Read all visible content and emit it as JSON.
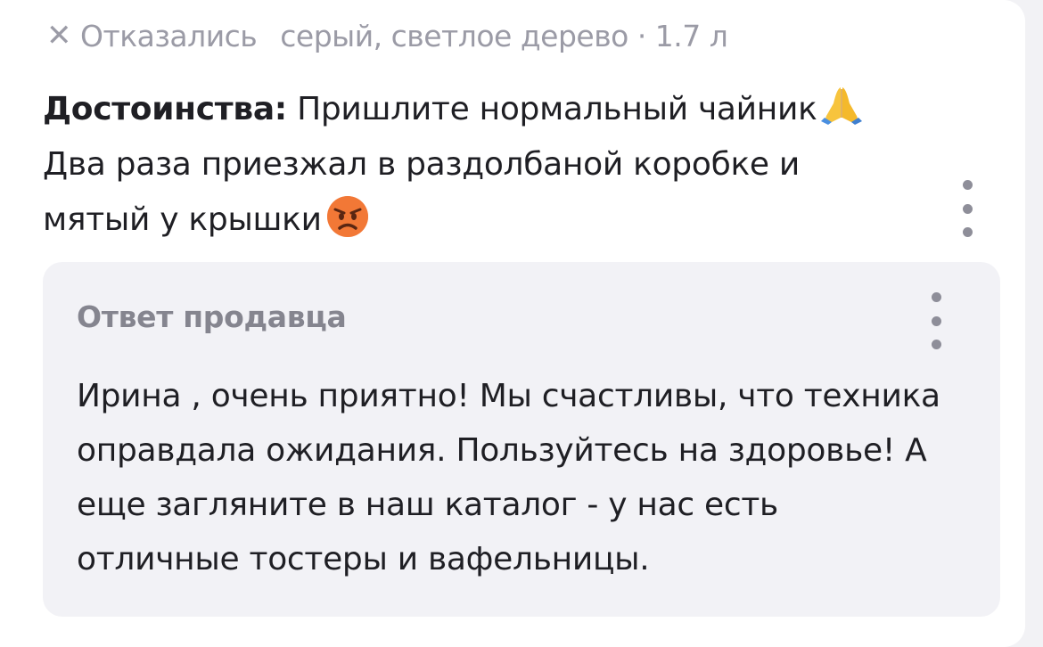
{
  "review": {
    "status_icon": "close-icon",
    "status_text": "Отказались",
    "variant_text": "серый, светлое дерево · 1.7 л",
    "pros_label": "Достоинства:",
    "pros_lines": [
      "Пришлите нормальный чайник",
      "Два раза приезжал в раздолбаной коробке и",
      "мятый у крышки"
    ],
    "emoji_1": "folded-hands-emoji",
    "emoji_2": "angry-face-emoji",
    "more_icon": "kebab-menu-icon"
  },
  "seller_reply": {
    "title": "Ответ продавца",
    "more_icon": "kebab-menu-icon",
    "text_lines": [
      "Ирина , очень приятно! Мы счастливы, что техника",
      "оправдала ожидания. Пользуйтесь на здоровье! А",
      "еще загляните в наш каталог - у нас есть",
      "отличные тостеры и вафельницы."
    ]
  },
  "colors": {
    "text_primary": "#1f1f24",
    "text_muted": "#9b9ba6",
    "reply_background": "#f2f2f6",
    "page_background": "#f2f2f5",
    "card_background": "#ffffff"
  }
}
